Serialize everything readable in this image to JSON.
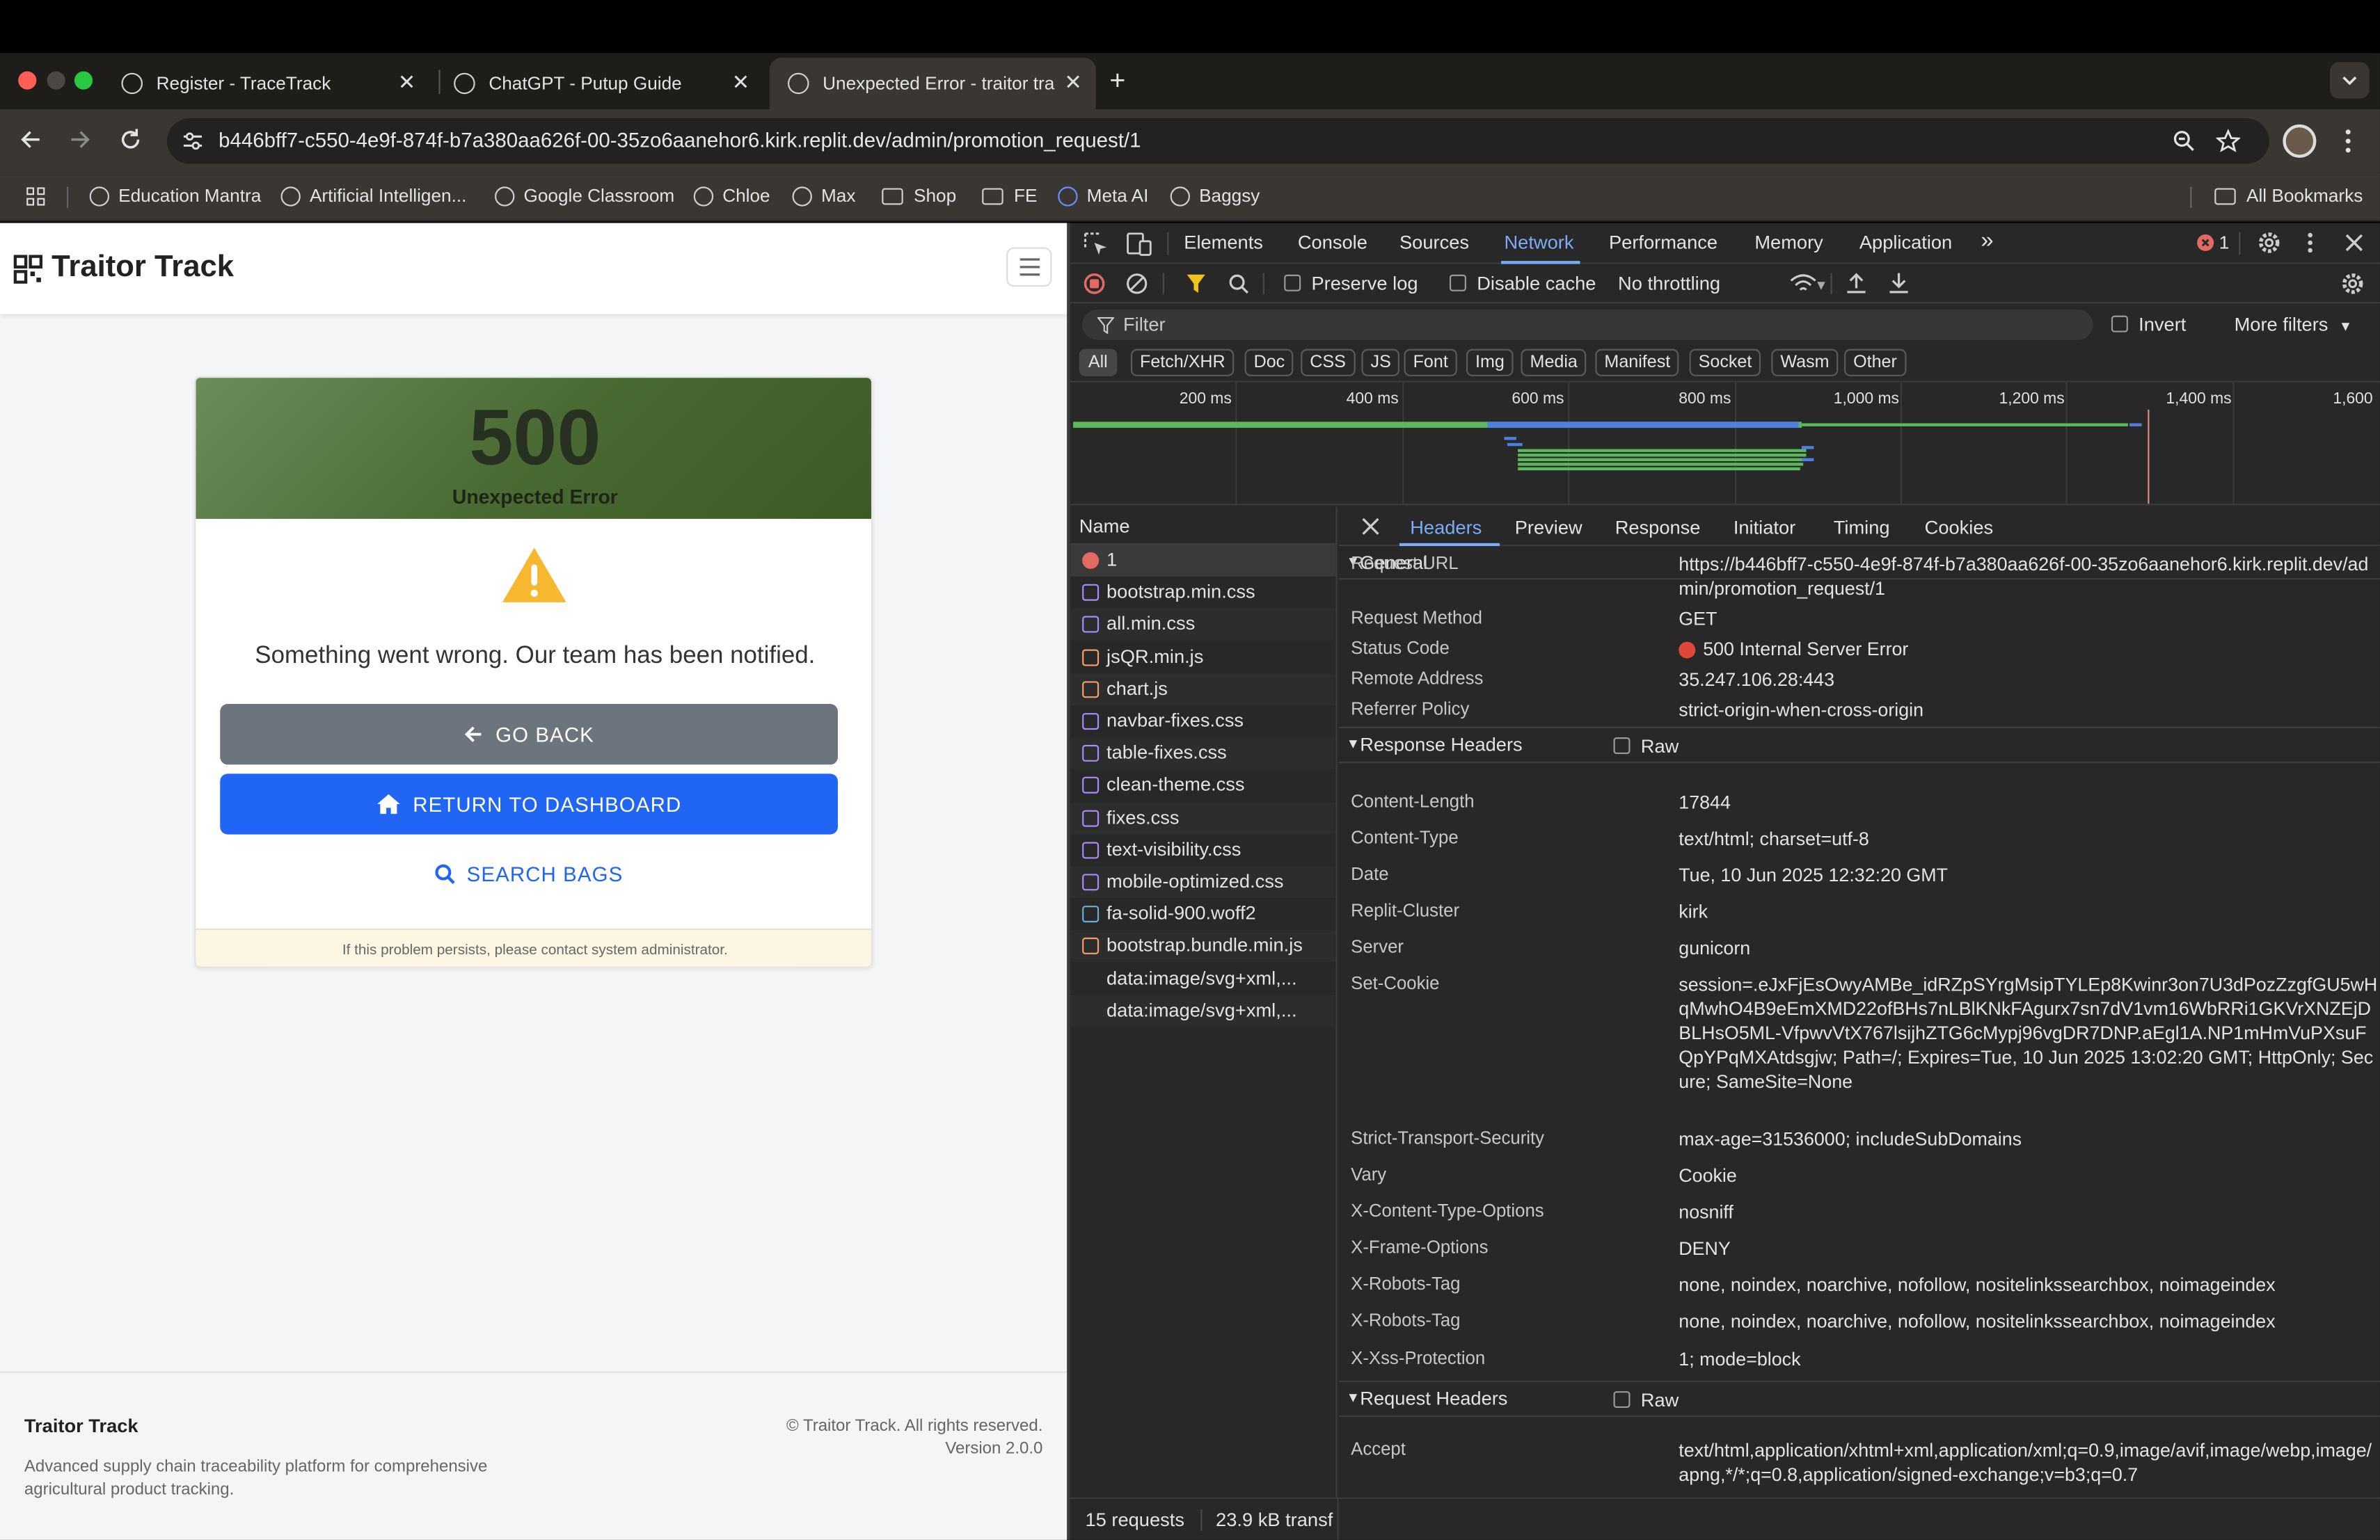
{
  "browser": {
    "tabs": [
      {
        "title": "Register - TraceTrack"
      },
      {
        "title": "ChatGPT - Putup Guide"
      },
      {
        "title": "Unexpected Error - traitor tra"
      }
    ],
    "url": "b446bff7-c550-4e9f-874f-b7a380aa626f-00-35zo6aanehor6.kirk.replit.dev/admin/promotion_request/1",
    "bookmarks": [
      "Education Mantra",
      "Artificial Intelligen...",
      "Google Classroom",
      "Chloe",
      "Max",
      "Shop",
      "FE",
      "Meta AI",
      "Baggsy"
    ],
    "all_bookmarks": "All Bookmarks"
  },
  "page": {
    "brand": "Traitor Track",
    "error_code": "500",
    "error_title": "Unexpected Error",
    "message": "Something went wrong. Our team has been notified.",
    "go_back": "GO BACK",
    "dashboard": "RETURN TO DASHBOARD",
    "search": "SEARCH BAGS",
    "card_footer": "If this problem persists, please contact system administrator.",
    "footer": {
      "name": "Traitor Track",
      "desc1": "Advanced supply chain traceability platform for comprehensive",
      "desc2": "agricultural product tracking.",
      "copyright": "© Traitor Track. All rights reserved.",
      "version": "Version 2.0.0"
    }
  },
  "devtools": {
    "tabs": [
      "Elements",
      "Console",
      "Sources",
      "Network",
      "Performance",
      "Memory",
      "Application"
    ],
    "active_tab": "Network",
    "error_count": "1",
    "preserve_log": "Preserve log",
    "disable_cache": "Disable cache",
    "throttling": "No throttling",
    "filter_placeholder": "Filter",
    "invert": "Invert",
    "more_filters": "More filters",
    "type_filters": [
      "All",
      "Fetch/XHR",
      "Doc",
      "CSS",
      "JS",
      "Font",
      "Img",
      "Media",
      "Manifest",
      "Socket",
      "Wasm",
      "Other"
    ],
    "timeline_labels": [
      "200 ms",
      "400 ms",
      "600 ms",
      "800 ms",
      "1,000 ms",
      "1,200 ms",
      "1,400 ms",
      "1,600"
    ],
    "name_header": "Name",
    "requests": [
      {
        "name": "1",
        "type": "error"
      },
      {
        "name": "bootstrap.min.css",
        "type": "css"
      },
      {
        "name": "all.min.css",
        "type": "css"
      },
      {
        "name": "jsQR.min.js",
        "type": "js"
      },
      {
        "name": "chart.js",
        "type": "js"
      },
      {
        "name": "navbar-fixes.css",
        "type": "css"
      },
      {
        "name": "table-fixes.css",
        "type": "css"
      },
      {
        "name": "clean-theme.css",
        "type": "css"
      },
      {
        "name": "fixes.css",
        "type": "css"
      },
      {
        "name": "text-visibility.css",
        "type": "css"
      },
      {
        "name": "mobile-optimized.css",
        "type": "css"
      },
      {
        "name": "fa-solid-900.woff2",
        "type": "font"
      },
      {
        "name": "bootstrap.bundle.min.js",
        "type": "js"
      },
      {
        "name": "data:image/svg+xml,...",
        "type": "img"
      },
      {
        "name": "data:image/svg+xml,...",
        "type": "img"
      }
    ],
    "detail_tabs": [
      "Headers",
      "Preview",
      "Response",
      "Initiator",
      "Timing",
      "Cookies"
    ],
    "general_title": "General",
    "general": [
      {
        "k": "Request URL",
        "v": "https://b446bff7-c550-4e9f-874f-b7a380aa626f-00-35zo6aanehor6.kirk.replit.dev/admin/promotion_request/1"
      },
      {
        "k": "Request Method",
        "v": "GET"
      },
      {
        "k": "Status Code",
        "v": "500 Internal Server Error"
      },
      {
        "k": "Remote Address",
        "v": "35.247.106.28:443"
      },
      {
        "k": "Referrer Policy",
        "v": "strict-origin-when-cross-origin"
      }
    ],
    "response_headers_title": "Response Headers",
    "raw_label": "Raw",
    "response_headers": [
      {
        "k": "Content-Length",
        "v": "17844"
      },
      {
        "k": "Content-Type",
        "v": "text/html; charset=utf-8"
      },
      {
        "k": "Date",
        "v": "Tue, 10 Jun 2025 12:32:20 GMT"
      },
      {
        "k": "Replit-Cluster",
        "v": "kirk"
      },
      {
        "k": "Server",
        "v": "gunicorn"
      },
      {
        "k": "Set-Cookie",
        "v": "session=.eJxFjEsOwyAMBe_idRZpSYrgMsipTYLEp8Kwinr3on7U3dPozZzgfGU5wHqMwhO4B9eEmXMD22ofBHs7nLBlKNkFAgurx7sn7dV1vm16WbRRi1GKVrXNZEjDBLHsO5ML-VfpwvVtX767lsijhZTG6cMypj96vgDR7DNP.aEgl1A.NP1mHmVuPXsuFQpYPqMXAtdsgjw; Path=/; Expires=Tue, 10 Jun 2025 13:02:20 GMT; HttpOnly; Secure; SameSite=None"
      },
      {
        "k": "Strict-Transport-Security",
        "v": "max-age=31536000; includeSubDomains"
      },
      {
        "k": "Vary",
        "v": "Cookie"
      },
      {
        "k": "X-Content-Type-Options",
        "v": "nosniff"
      },
      {
        "k": "X-Frame-Options",
        "v": "DENY"
      },
      {
        "k": "X-Robots-Tag",
        "v": "none, noindex, noarchive, nofollow, nositelinkssearchbox, noimageindex"
      },
      {
        "k": "X-Robots-Tag",
        "v": "none, noindex, noarchive, nofollow, nositelinkssearchbox, noimageindex"
      },
      {
        "k": "X-Xss-Protection",
        "v": "1; mode=block"
      }
    ],
    "request_headers_title": "Request Headers",
    "request_headers": [
      {
        "k": "Accept",
        "v": "text/html,application/xhtml+xml,application/xml;q=0.9,image/avif,image/webp,image/apng,*/*;q=0.8,application/signed-exchange;v=b3;q=0.7"
      }
    ],
    "status_requests": "15 requests",
    "status_transferred": "23.9 kB transf"
  }
}
